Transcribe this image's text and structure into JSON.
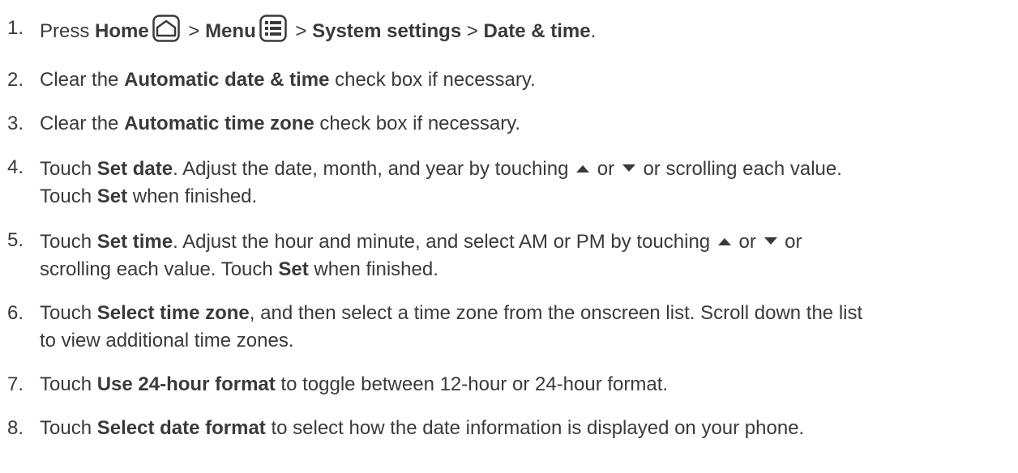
{
  "steps": [
    {
      "num": "1.",
      "t1": "Press ",
      "b1": "Home",
      "icon1": "home-icon",
      "t2": " > ",
      "b2": "Menu",
      "icon2": "menu-icon",
      "t3": " > ",
      "b3": "System settings",
      "t4": " > ",
      "b4": "Date & time",
      "t5": "."
    },
    {
      "num": "2.",
      "t1": "Clear the ",
      "b1": "Automatic date & time",
      "t2": " check box if necessary."
    },
    {
      "num": "3.",
      "t1": "Clear the ",
      "b1": "Automatic time zone",
      "t2": " check box if necessary."
    },
    {
      "num": "4.",
      "t1": "Touch ",
      "b1": "Set date",
      "t2": ". Adjust the date, month, and year by touching ",
      "icon1": "up-triangle-icon",
      "t3": " or ",
      "icon2": "down-triangle-icon",
      "t4": " or scrolling each value.",
      "t5": "Touch ",
      "b2": "Set",
      "t6": " when finished."
    },
    {
      "num": "5.",
      "t1": "Touch ",
      "b1": "Set time",
      "t2": ". Adjust the hour and minute, and select AM or PM by touching ",
      "icon1": "up-triangle-icon",
      "t3": " or ",
      "icon2": "down-triangle-icon",
      "t4": " or",
      "t5": "scrolling each value. Touch ",
      "b2": "Set",
      "t6": " when finished."
    },
    {
      "num": "6.",
      "t1": "Touch ",
      "b1": "Select time zone",
      "t2": ", and then select a time zone from the onscreen list. Scroll down the list",
      "t3": "to view additional time zones."
    },
    {
      "num": "7.",
      "t1": "Touch ",
      "b1": "Use 24-hour format",
      "t2": " to toggle between 12-hour or 24-hour format."
    },
    {
      "num": "8.",
      "t1": "Touch ",
      "b1": "Select date format",
      "t2": " to select how the date information is displayed on your phone."
    }
  ]
}
